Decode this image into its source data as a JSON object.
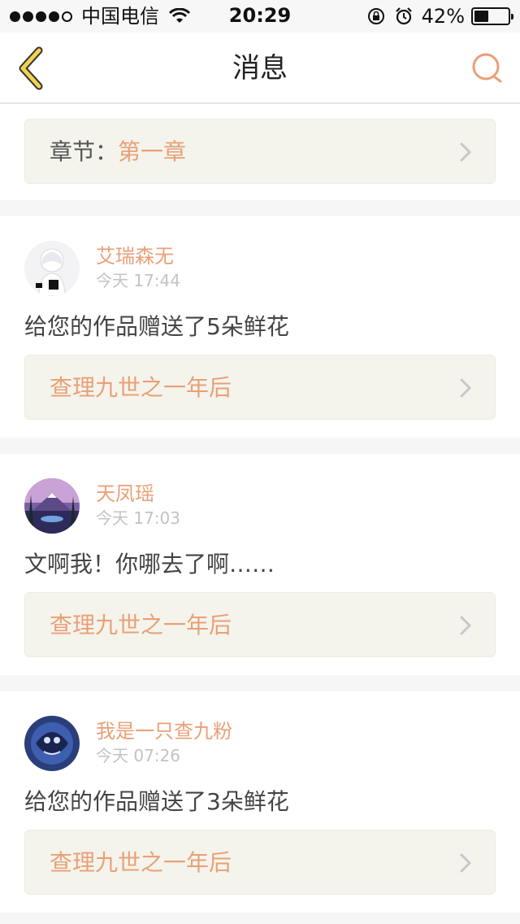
{
  "status_bar": {
    "carrier": "中国电信",
    "time": "20:29",
    "battery_percent": "42%",
    "battery_level": 0.42
  },
  "nav": {
    "title": "消息"
  },
  "chapter": {
    "prefix": "章节：",
    "name": "第一章"
  },
  "messages": [
    {
      "sender": "艾瑞森无",
      "time": "今天 17:44",
      "text": "给您的作品赠送了5朵鲜花",
      "work": "查理九世之一年后"
    },
    {
      "sender": "天凤瑶",
      "time": "今天 17:03",
      "text": "文啊我！你哪去了啊……",
      "work": "查理九世之一年后"
    },
    {
      "sender": "我是一只查九粉",
      "time": "今天 07:26",
      "text": "给您的作品赠送了3朵鲜花",
      "work": "查理九世之一年后"
    }
  ],
  "colors": {
    "accent": "#e9a077",
    "link_bg": "#f4f4ec",
    "back_icon": "#f2d34f"
  },
  "icons": {
    "back": "chevron-left-icon",
    "search": "search-icon",
    "wifi": "wifi-icon",
    "orientation_lock": "orientation-lock-icon",
    "alarm": "alarm-icon"
  }
}
